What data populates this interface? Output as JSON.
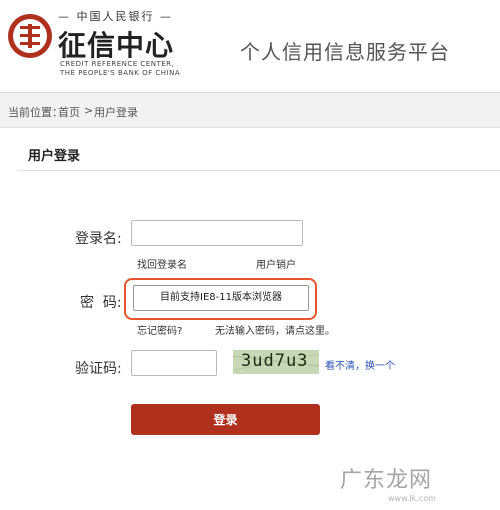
{
  "header": {
    "logo_top": "— 中国人民银行 —",
    "logo_title": "征信中心",
    "logo_en_line1": "CREDIT REFERENCE CENTER,",
    "logo_en_line2": "THE PEOPLE'S BANK OF CHINA",
    "platform_title": "个人信用信息服务平台"
  },
  "breadcrumb": {
    "prefix": "当前位置：",
    "home": "首页",
    "separator": ">",
    "current": "用户登录"
  },
  "section": {
    "title": "用户登录"
  },
  "form": {
    "username_label": "登录名:",
    "username_value": "",
    "find_login_link": "找回登录名",
    "cancel_user_link": "用户销户",
    "password_label": "密  码:",
    "password_hint": "目前支持IE8-11版本浏览器",
    "forgot_password_link": "忘记密码?",
    "cannot_input_link": "无法输入密码，请点这里。",
    "captcha_label": "验证码:",
    "captcha_value": "",
    "captcha_text": "3ud7u3",
    "refresh_captcha_link": "看不清，换一个",
    "login_button": "登录"
  },
  "watermark": {
    "text": "广东龙网",
    "sub": "www.lk.com"
  },
  "colors": {
    "accent_red": "#b0301e",
    "highlight_orange": "#e8542b",
    "link_blue": "#2a55b8",
    "captcha_bg": "#c7d8b6"
  }
}
